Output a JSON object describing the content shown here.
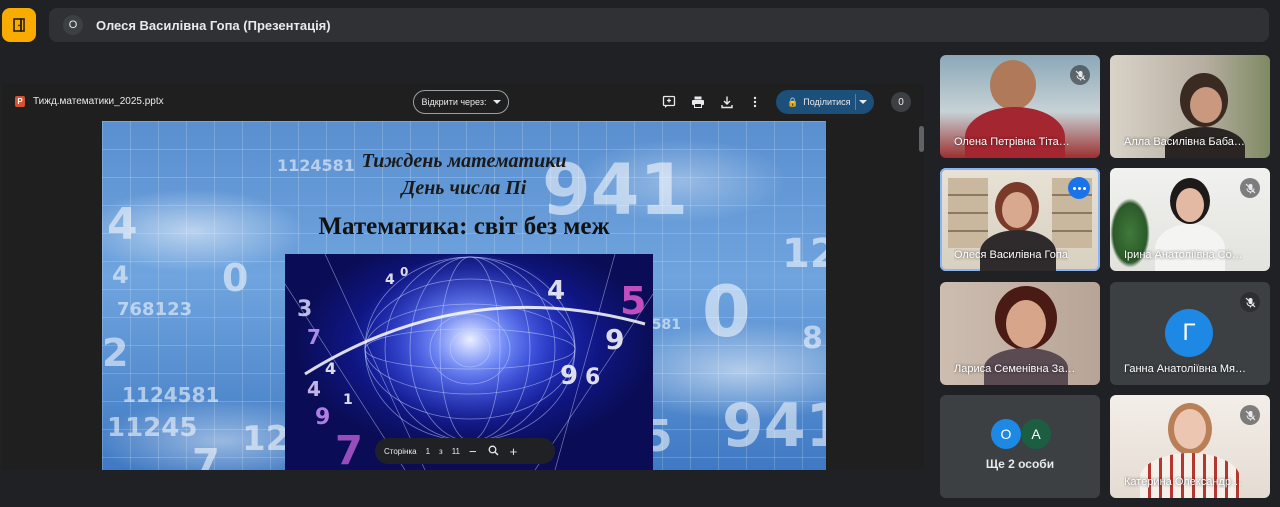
{
  "top_bar": {
    "badge": "О",
    "title": "Олеся Василівна Гопа (Презентація)"
  },
  "presentation": {
    "file_icon": "P",
    "file_name": "Тижд.математики_2025.pptx",
    "open_with_label": "Відкрити через:",
    "share_label": "Поділитися",
    "viewer_count": "0",
    "icons": [
      "add-comment-icon",
      "print-icon",
      "download-icon",
      "more-vert-icon",
      "lock-icon"
    ]
  },
  "slide": {
    "title_line1": "Тиждень математики",
    "title_line2": "День числа Пі",
    "heading": "Математика: світ без меж",
    "background_numbers": [
      "1124581",
      "941",
      "4",
      "0",
      "4",
      "768123",
      "2",
      "1124581",
      "11245",
      "12",
      "7",
      "4581",
      "0",
      "941",
      "12",
      "5",
      "9",
      "8"
    ],
    "art_numbers": [
      "3",
      "7",
      "4",
      "4",
      "9",
      "1",
      "4",
      "0",
      "7",
      "9",
      "4",
      "9",
      "5",
      "6"
    ]
  },
  "page_control": {
    "label": "Сторінка",
    "current": "1",
    "separator": "з",
    "total": "11",
    "zoom_out_glyph": "−",
    "zoom_in_glyph": "+"
  },
  "participants": [
    {
      "name": "Олена Петрівна Тіта…",
      "muted": true
    },
    {
      "name": "Алла Василівна Баба…",
      "muted": false
    },
    {
      "name": "Олеся Василівна Гопа",
      "muted": false,
      "active": true
    },
    {
      "name": "Ірина Анатоліївна Со…",
      "muted": true
    },
    {
      "name": "Лариса Семенівна За…",
      "muted": false
    },
    {
      "name": "Ганна Анатоліївна Мя…",
      "muted": true,
      "avatar": "Г",
      "avatar_color": "#1e88e5"
    },
    {
      "name": "Катерина Олександр…",
      "muted": true
    }
  ],
  "more_people": {
    "label": "Ще 2 особи",
    "avatars": [
      {
        "letter": "О",
        "color": "#1e88e5"
      },
      {
        "letter": "А",
        "color": "#1b5e42"
      }
    ]
  },
  "colors": {
    "background": "#202124",
    "exit_button": "#f9ab00",
    "share_button": "#1c4f7a",
    "active_outline": "#8ab4f8"
  }
}
